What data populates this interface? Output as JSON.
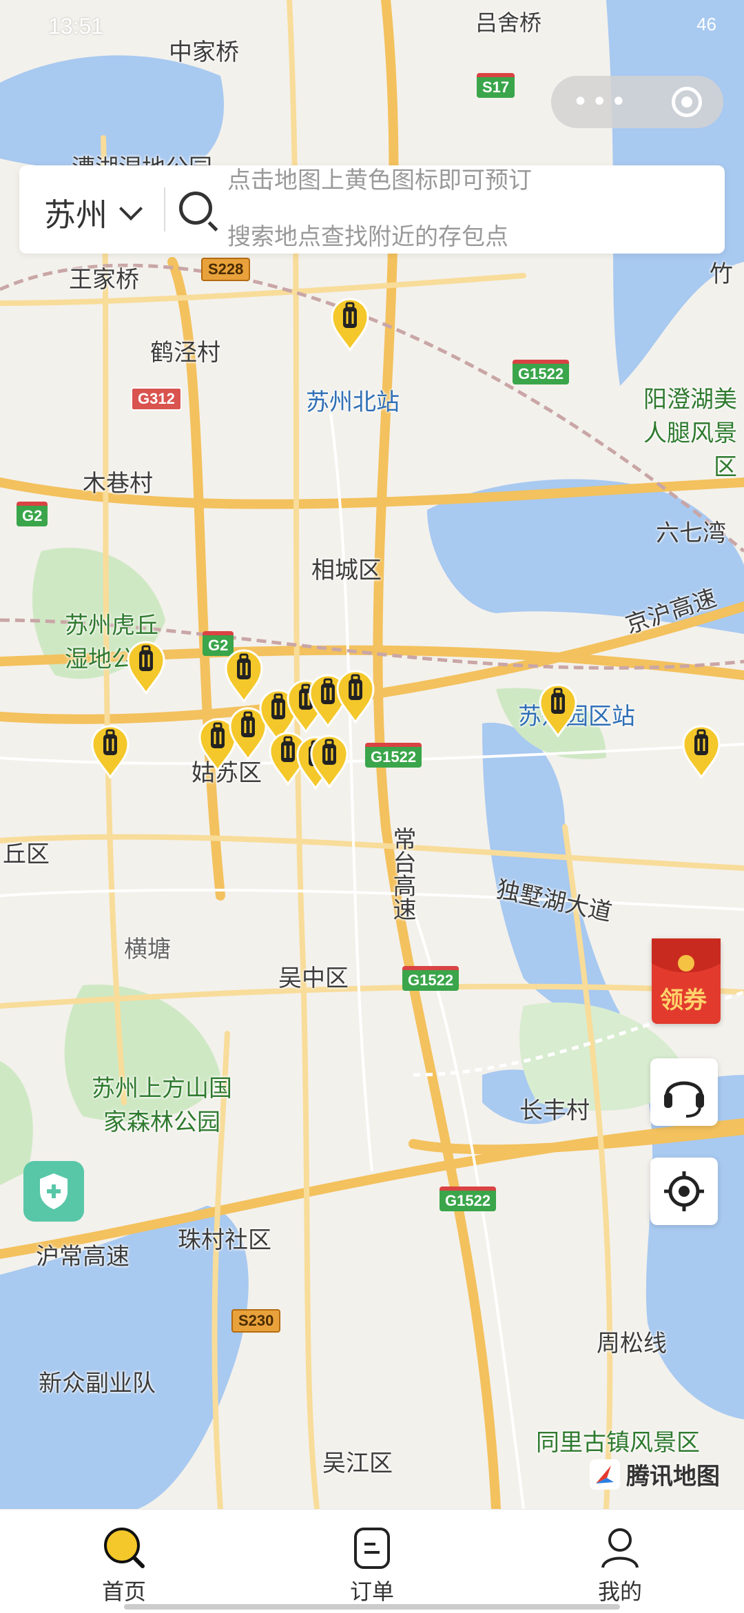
{
  "status_bar": {
    "time": "13:51",
    "right": "46"
  },
  "search": {
    "city": "苏州",
    "hint_line1": "点击地图上黄色图标即可预订",
    "hint_line2": "搜索地点查找附近的存包点"
  },
  "map_labels": [
    "吕舍桥",
    "中家桥",
    "漕湖湿地公园",
    "王家桥",
    "竹",
    "鹤泾村",
    "苏州北站",
    "木巷村",
    "阳澄湖美人腿风景区",
    "六七湾",
    "相城区",
    "苏州虎丘湿地公园",
    "京沪高速",
    "常台高速",
    "苏州园区站",
    "姑苏区",
    "丘区",
    "独墅湖大道",
    "横塘",
    "吴中区",
    "苏州上方山国家森林公园",
    "长丰村",
    "珠村社区",
    "沪常高速",
    "新众副业队",
    "周松线",
    "同里古镇风景区",
    "吴江区"
  ],
  "road_badges": [
    "S17",
    "S228",
    "G312",
    "G1522",
    "G2",
    "G2",
    "G1522",
    "G1522",
    "G1522",
    "S230"
  ],
  "coupon_label": "领券",
  "tencent_label": "腾讯地图",
  "tabs": [
    {
      "label": "首页",
      "icon": "home-search-icon"
    },
    {
      "label": "订单",
      "icon": "order-icon"
    },
    {
      "label": "我的",
      "icon": "profile-icon"
    }
  ],
  "colors": {
    "accent": "#f4c82a",
    "water": "#a8c9f0",
    "park": "#cfe8c4",
    "road": "#f3c15d"
  }
}
